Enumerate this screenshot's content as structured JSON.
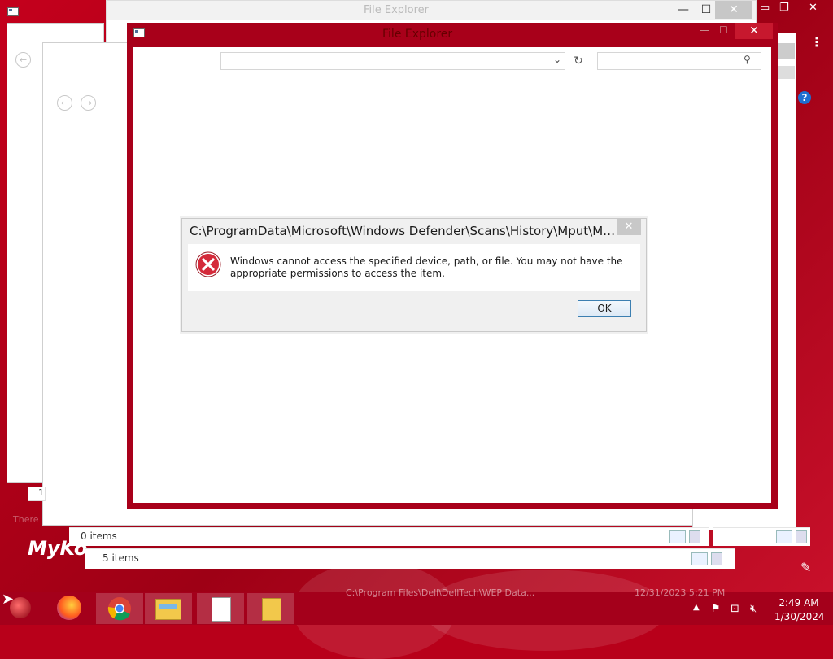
{
  "desktop": {
    "watermark_text": "MyKo",
    "ghost_label": "There"
  },
  "back_window_1": {
    "title": "File Explorer",
    "status_text": "5 items"
  },
  "back_window_2": {
    "status_text": "0 items",
    "left_count": "1"
  },
  "main_window": {
    "title": "File Explorer",
    "address_value": "",
    "search_placeholder": ""
  },
  "dialog": {
    "title": "C:\\ProgramData\\Microsoft\\Windows Defender\\Scans\\History\\Mput\\MputHist...",
    "message": "Windows cannot access the specified device, path, or file. You may not have the appropriate permissions to access the item.",
    "ok_label": "OK",
    "close_glyph": "✕"
  },
  "taskbar": {
    "ghost_path": "C:\\Program Files\\Dell\\DellTech\\WEP Data...",
    "ghost_date": "12/31/2023 5:21 PM",
    "time": "2:49 AM",
    "date": "1/30/2024",
    "items": [
      {
        "name": "firefox",
        "icon": "firefox-icon"
      },
      {
        "name": "chrome",
        "icon": "chrome-icon"
      },
      {
        "name": "file-explorer",
        "icon": "file-explorer-icon"
      },
      {
        "name": "notepad",
        "icon": "notepad-icon"
      },
      {
        "name": "folder",
        "icon": "folder-icon"
      }
    ]
  },
  "colors": {
    "accent": "#a8001a",
    "dialog_bg": "#f0f0f0",
    "error_red": "#d42a3a",
    "button_border": "#3c7fb1"
  }
}
